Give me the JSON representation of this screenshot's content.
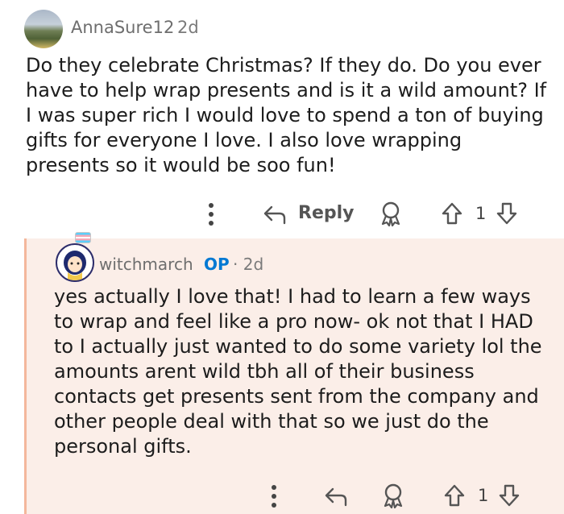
{
  "comment": {
    "username": "AnnaSure12",
    "time_ago": "2d",
    "body": "Do they celebrate Christmas? If they do. Do you ever have to help wrap presents and is it a wild amount? If I was super rich I would love to spend a ton of buying gifts for everyone I love. I also love wrapping presents so it would be soo fun!",
    "reply_label": "Reply",
    "vote_count": "1"
  },
  "reply": {
    "username": "witchmarch",
    "op_badge": "OP",
    "time_ago": "· 2d",
    "body": "yes actually I love that! I had to learn a few ways to wrap and feel like a pro now- ok not that I HAD to I actually just wanted to do some variety lol the amounts arent wild tbh all of their business contacts get presents sent from the company and other people deal with that so we just do the personal gifts.",
    "vote_count": "1"
  },
  "icons": {
    "more": "more-vertical-icon",
    "reply": "reply-arrow-icon",
    "award": "award-icon",
    "upvote": "upvote-arrow-icon",
    "downvote": "downvote-arrow-icon"
  },
  "colors": {
    "thread_background": "#fbeee8",
    "thread_line": "#f4b79c",
    "op_badge": "#0079d3",
    "meta_text": "#6e6e6e"
  }
}
